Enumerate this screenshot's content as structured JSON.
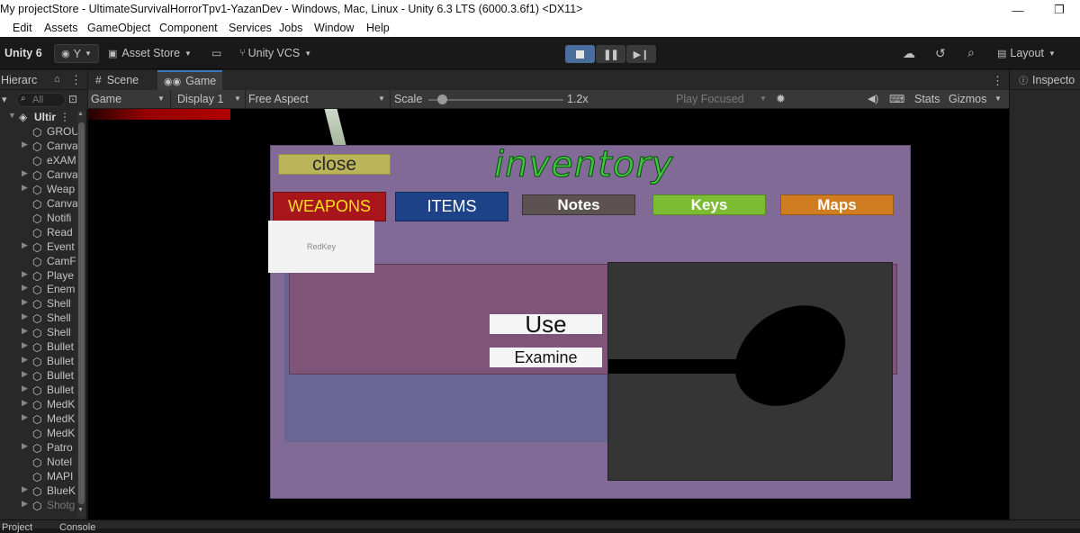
{
  "window": {
    "title": "My projectStore - UltimateSurvivalHorrorTpv1-YazanDev - Windows, Mac, Linux - Unity 6.3 LTS (6000.3.6f1) <DX11>",
    "minimize": "—",
    "restore": "❐"
  },
  "menu": [
    "Edit",
    "Assets",
    "GameObject",
    "Component",
    "Services",
    "Jobs",
    "Window",
    "Help"
  ],
  "toolbar": {
    "unity_label": "Unity 6",
    "account_label": "Y",
    "asset_store": "Asset Store",
    "vcs": "Unity VCS",
    "layout": "Layout"
  },
  "hierarchy": {
    "tab": "Hierarc",
    "search_placeholder": "All",
    "root": "Ultir",
    "items": [
      "GROU",
      "Canva",
      "eXAM",
      "Canva",
      "Weap",
      "Canva",
      "Notifi",
      "Read",
      "Event",
      "CamF",
      "Playe",
      "Enem",
      "Shell",
      "Shell",
      "Shell",
      "Bullet",
      "Bullet",
      "Bullet",
      "Bullet",
      "MedK",
      "MedK",
      "MedK",
      "Patro",
      "Notel",
      "MAPI",
      "BlueK",
      "Shotg"
    ]
  },
  "game_view": {
    "tabs": [
      "Scene",
      "Game"
    ],
    "mode": "Game",
    "display": "Display 1",
    "aspect": "Free Aspect",
    "scale_label": "Scale",
    "scale_value": "1.2x",
    "scale_level": 0.1,
    "play_focused": "Play Focused",
    "stats": "Stats",
    "gizmos": "Gizmos"
  },
  "inspector": {
    "tab": "Inspecto"
  },
  "bottom": {
    "project": "Project",
    "console": "Console"
  },
  "inventory": {
    "title": "inventory",
    "close": "close",
    "tabs": [
      "WEAPONS",
      "ITEMS",
      "Notes",
      "Keys",
      "Maps"
    ],
    "item_slot": "RedKey",
    "use": "Use",
    "examine": "Examine"
  },
  "colors": {
    "panel": "#816a96",
    "weapons_bg": "#a8161b",
    "weapons_text": "#f2e21e",
    "items_bg": "#1d4287",
    "notes_bg": "#5c5252",
    "keys_bg": "#7cbc32",
    "maps_bg": "#d07c20",
    "title_green": "#3dc53d",
    "play_active": "#4a6d9c"
  }
}
